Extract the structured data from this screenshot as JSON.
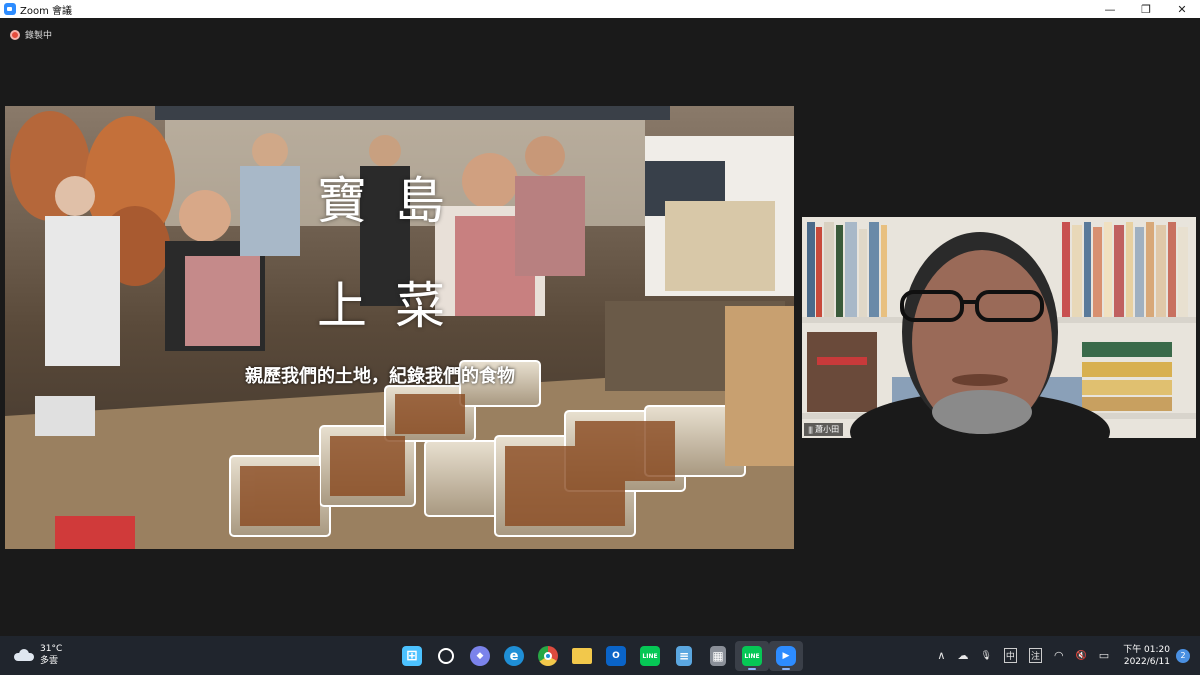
{
  "window": {
    "title": "Zoom 會議",
    "controls": [
      "—",
      "❐",
      "✕"
    ]
  },
  "recording": {
    "label": "錄製中"
  },
  "shared_screen": {
    "title_line1": "寶島",
    "title_line2": "上菜",
    "subtitle": "親歷我們的土地，紀錄我們的食物"
  },
  "participant": {
    "name": "蕭小田"
  },
  "taskbar": {
    "weather": {
      "temp": "31°C",
      "condition": "多雲"
    },
    "apps": [
      {
        "name": "start",
        "glyph": "⊞",
        "color": "#4cc2ff"
      },
      {
        "name": "search",
        "glyph": "○",
        "color": "#20252d"
      },
      {
        "name": "teams-chat",
        "glyph": "◆",
        "color": "#7b83eb"
      },
      {
        "name": "edge",
        "glyph": "e",
        "color": "#1f8fd6"
      },
      {
        "name": "chrome",
        "glyph": "●",
        "color": "#dd4b3e"
      },
      {
        "name": "file-explorer",
        "glyph": "▬",
        "color": "#f2c84b"
      },
      {
        "name": "outlook",
        "glyph": "O",
        "color": "#0a64c8"
      },
      {
        "name": "line",
        "glyph": "LINE",
        "color": "#06c755"
      },
      {
        "name": "notepad",
        "glyph": "≡",
        "color": "#5ba7e0"
      },
      {
        "name": "calculator",
        "glyph": "▦",
        "color": "#8a8f98"
      },
      {
        "name": "line-active",
        "glyph": "LINE",
        "color": "#06c755"
      },
      {
        "name": "zoom",
        "glyph": "▶",
        "color": "#2d8cff"
      }
    ],
    "tray": {
      "chevron": "∧",
      "onedrive": "☁",
      "mic": "🎙",
      "ime1": "中",
      "ime2": "注",
      "wifi": "◠",
      "volume": "🔇",
      "battery": "▭"
    },
    "clock": {
      "time": "下午 01:20",
      "date": "2022/6/11"
    },
    "notifications": "2"
  }
}
